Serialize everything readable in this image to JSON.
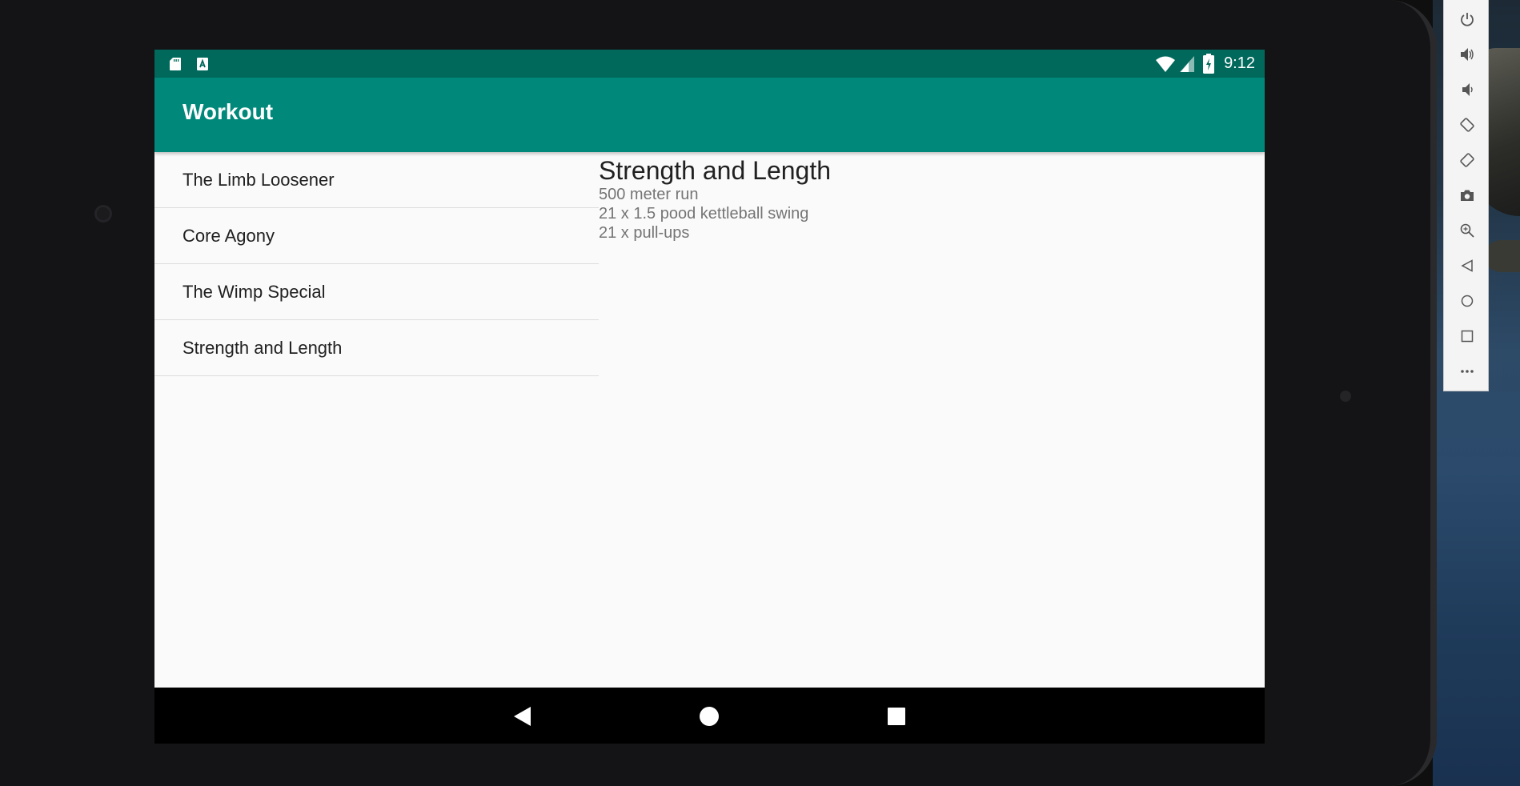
{
  "status_bar": {
    "time": "9:12",
    "left_icons": [
      "sd-card-icon",
      "keyboard-a-icon"
    ],
    "right_icons": [
      "wifi-icon",
      "cell-signal-icon",
      "battery-charging-icon"
    ]
  },
  "app_bar": {
    "title": "Workout"
  },
  "workouts": [
    {
      "name": "The Limb Loosener"
    },
    {
      "name": "Core Agony"
    },
    {
      "name": "The Wimp Special"
    },
    {
      "name": "Strength and Length"
    }
  ],
  "detail": {
    "title": "Strength and Length",
    "lines": [
      "500 meter run",
      "21 x 1.5 pood kettleball swing",
      "21 x pull-ups"
    ]
  },
  "nav_bar": {
    "buttons": [
      "back-icon",
      "home-icon",
      "recents-icon"
    ]
  },
  "emulator_toolbar": {
    "buttons": [
      "power-icon",
      "volume-up-icon",
      "volume-down-icon",
      "rotate-left-icon",
      "rotate-right-icon",
      "camera-icon",
      "zoom-icon",
      "back-icon",
      "home-icon",
      "overview-icon",
      "more-icon"
    ]
  },
  "colors": {
    "status_bar": "#00695c",
    "app_bar": "#00897b",
    "background": "#fafafa",
    "nav_bar": "#000000"
  }
}
